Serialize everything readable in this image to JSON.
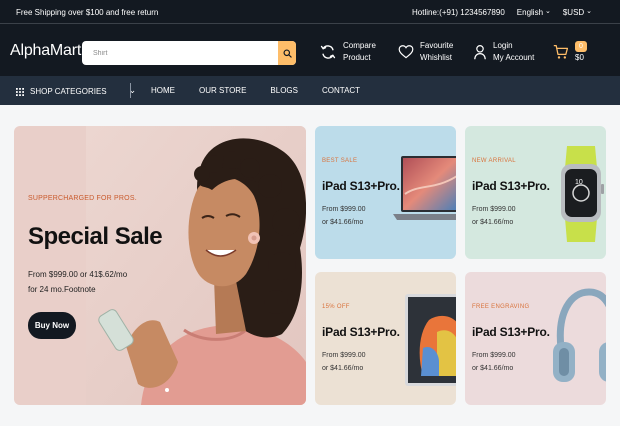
{
  "topbar": {
    "shipping_text": "Free Shipping over $100 and free return",
    "hotline": "Hotline:(+91) 1234567890",
    "language": "English",
    "currency": "$USD"
  },
  "header": {
    "logo": "AlphaMart",
    "search_placeholder": "Shirt",
    "compare": [
      "Compare",
      "Product"
    ],
    "favourite": [
      "Favourite",
      "Whishlist"
    ],
    "account": [
      "Login",
      "My Account"
    ],
    "cart_count": "0",
    "cart_total": "$0"
  },
  "nav": {
    "categories_label": "SHOP CATEGORIES",
    "links": [
      "HOME",
      "OUR STORE",
      "BLOGS",
      "CONTACT"
    ]
  },
  "hero": {
    "tag": "SUPPERCHARGED FOR PROS.",
    "title": "Special Sale",
    "desc_line1": "From $999.00 or 41$.62/mo",
    "desc_line2": "for 24 mo.Footnote",
    "button": "Buy Now"
  },
  "cards": [
    {
      "tag": "BEST SALE",
      "name": "iPad S13+Pro.",
      "price1": "From $999.00",
      "price2": "or $41.66/mo",
      "bg": "#bcdcea",
      "product": "laptop"
    },
    {
      "tag": "NEW ARRIVAL",
      "name": "iPad S13+Pro.",
      "price1": "From $999.00",
      "price2": "or $41.66/mo",
      "bg": "#d4e8df",
      "product": "smartwatch"
    },
    {
      "tag": "15% OFF",
      "name": "iPad S13+Pro.",
      "price1": "From $999.00",
      "price2": "or $41.66/mo",
      "bg": "#ece1d4",
      "product": "tablet"
    },
    {
      "tag": "FREE ENGRAVING",
      "name": "iPad S13+Pro.",
      "price1": "From $999.00",
      "price2": "or $41.66/mo",
      "bg": "#ecdbdc",
      "product": "headphones"
    }
  ],
  "colors": {
    "dark": "#131921",
    "nav": "#232f3e",
    "accent": "#febd69"
  }
}
